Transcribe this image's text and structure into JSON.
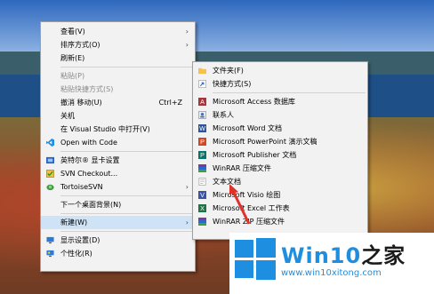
{
  "context_menu": {
    "items": [
      {
        "label": "查看(V)",
        "arrow": true
      },
      {
        "label": "排序方式(O)",
        "arrow": true
      },
      {
        "label": "刷新(E)"
      },
      {
        "label": "粘贴(P)",
        "disabled": true
      },
      {
        "label": "粘贴快捷方式(S)",
        "disabled": true
      },
      {
        "label": "撤消 移动(U)",
        "shortcut": "Ctrl+Z"
      },
      {
        "label": "关机"
      },
      {
        "label": "在 Visual Studio 中打开(V)"
      },
      {
        "label": "Open with Code"
      },
      {
        "label": "英特尔® 显卡设置"
      },
      {
        "label": "SVN Checkout..."
      },
      {
        "label": "TortoiseSVN",
        "arrow": true
      },
      {
        "label": "下一个桌面背景(N)"
      },
      {
        "label": "新建(W)",
        "arrow": true
      },
      {
        "label": "显示设置(D)"
      },
      {
        "label": "个性化(R)"
      }
    ]
  },
  "new_submenu": {
    "items": [
      {
        "label": "文件夹(F)",
        "icon": "folder-icon"
      },
      {
        "label": "快捷方式(S)",
        "icon": "shortcut-icon"
      },
      {
        "label": "Microsoft Access 数据库",
        "icon": "access-icon"
      },
      {
        "label": "联系人",
        "icon": "contact-icon"
      },
      {
        "label": "Microsoft Word 文档",
        "icon": "word-icon"
      },
      {
        "label": "Microsoft PowerPoint 演示文稿",
        "icon": "powerpoint-icon"
      },
      {
        "label": "Microsoft Publisher 文档",
        "icon": "publisher-icon"
      },
      {
        "label": "WinRAR 压缩文件",
        "icon": "winrar-icon"
      },
      {
        "label": "文本文档",
        "icon": "text-document-icon"
      },
      {
        "label": "Microsoft Visio 绘图",
        "icon": "visio-icon"
      },
      {
        "label": "Microsoft Excel 工作表",
        "icon": "excel-icon"
      },
      {
        "label": "WinRAR ZIP 压缩文件",
        "icon": "winrar-zip-icon"
      }
    ]
  },
  "watermark": {
    "brand_prefix": "Win10",
    "brand_suffix": "之家",
    "url": "www.win10xitong.com"
  },
  "colors": {
    "accent": "#1e8fe0",
    "highlight": "#cfe3f7",
    "arrow": "#e0312a"
  }
}
